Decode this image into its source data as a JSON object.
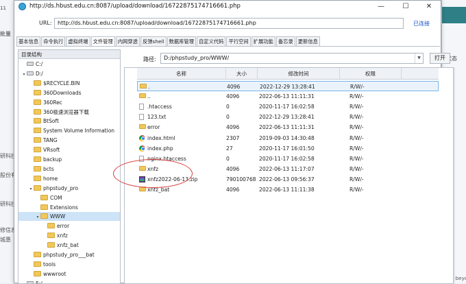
{
  "background": {
    "left_time": "11",
    "left_fragment": "批量",
    "left_side_labels": [
      "研科技",
      "股份有",
      "研科技",
      "修信息",
      "城惠"
    ],
    "status_column": "状态",
    "corner_text": "by rebeyon"
  },
  "window": {
    "title": "http://ds.hbust.edu.cn:8087/upload/download/16722875174716661.php",
    "minimize": "—",
    "maximize": "☐",
    "close": "✕"
  },
  "url_bar": {
    "label": "URL:",
    "value": "http://ds.hbust.edu.cn:8087/upload/download/16722875174716661.php",
    "status": "已连接"
  },
  "tabs": [
    "基本信息",
    "命令执行",
    "虚拟终端",
    "文件管理",
    "内网穿透",
    "反弹shell",
    "数据库管理",
    "自定义代码",
    "平行空间",
    "扩展功能",
    "备忘录",
    "更新信息"
  ],
  "active_tab": "文件管理",
  "tree": {
    "header": "目录结构",
    "nodes": [
      {
        "label": "C:/",
        "type": "drive",
        "depth": 1,
        "expander": ""
      },
      {
        "label": "D:/",
        "type": "drive",
        "depth": 1,
        "expander": "▾"
      },
      {
        "label": "$RECYCLE.BIN",
        "type": "folder",
        "depth": 2,
        "expander": ""
      },
      {
        "label": "360Downloads",
        "type": "folder",
        "depth": 2,
        "expander": ""
      },
      {
        "label": "360Rec",
        "type": "folder",
        "depth": 2,
        "expander": ""
      },
      {
        "label": "360极速浏览器下载",
        "type": "folder",
        "depth": 2,
        "expander": ""
      },
      {
        "label": "BtSoft",
        "type": "folder",
        "depth": 2,
        "expander": ""
      },
      {
        "label": "System Volume Information",
        "type": "folder",
        "depth": 2,
        "expander": ""
      },
      {
        "label": "TANG",
        "type": "folder",
        "depth": 2,
        "expander": ""
      },
      {
        "label": "VRsoft",
        "type": "folder",
        "depth": 2,
        "expander": ""
      },
      {
        "label": "backup",
        "type": "folder",
        "depth": 2,
        "expander": ""
      },
      {
        "label": "bcts",
        "type": "folder",
        "depth": 2,
        "expander": ""
      },
      {
        "label": "home",
        "type": "folder",
        "depth": 2,
        "expander": ""
      },
      {
        "label": "phpstudy_pro",
        "type": "folder",
        "depth": 2,
        "expander": "▾"
      },
      {
        "label": "COM",
        "type": "folder",
        "depth": 3,
        "expander": ""
      },
      {
        "label": "Extensions",
        "type": "folder",
        "depth": 3,
        "expander": ""
      },
      {
        "label": "WWW",
        "type": "folder",
        "depth": 3,
        "expander": "▾",
        "selected": true
      },
      {
        "label": "error",
        "type": "folder",
        "depth": 4,
        "expander": ""
      },
      {
        "label": "xnfz",
        "type": "folder",
        "depth": 4,
        "expander": ""
      },
      {
        "label": "xnfz_bat",
        "type": "folder",
        "depth": 4,
        "expander": ""
      },
      {
        "label": "phpstudy_pro___bat",
        "type": "folder",
        "depth": 2,
        "expander": ""
      },
      {
        "label": "tools",
        "type": "folder",
        "depth": 2,
        "expander": ""
      },
      {
        "label": "wwwroot",
        "type": "folder",
        "depth": 2,
        "expander": ""
      },
      {
        "label": "E:/",
        "type": "drive",
        "depth": 1,
        "expander": ""
      }
    ]
  },
  "path_bar": {
    "label": "路径:",
    "value": "D:/phpstudy_pro/WWW/",
    "open_button": "打开"
  },
  "file_list": {
    "columns": [
      "名称",
      "大小",
      "修改时间",
      "权限"
    ],
    "rows": [
      {
        "name": ".",
        "size": "4096",
        "mtime": "2022-12-29 13:28:41",
        "perm": "R/W/-",
        "icon": "folder-icon",
        "selected": true
      },
      {
        "name": "..",
        "size": "4096",
        "mtime": "2022-06-13 11:11:31",
        "perm": "R/W/-",
        "icon": "folder-icon"
      },
      {
        "name": ".htaccess",
        "size": "0",
        "mtime": "2020-11-17 16:02:58",
        "perm": "R/W/-",
        "icon": "file-icon"
      },
      {
        "name": "123.txt",
        "size": "0",
        "mtime": "2022-12-29 13:28:41",
        "perm": "R/W/-",
        "icon": "file-icon"
      },
      {
        "name": "error",
        "size": "4096",
        "mtime": "2022-06-13 11:11:31",
        "perm": "R/W/-",
        "icon": "folder-icon"
      },
      {
        "name": "index.html",
        "size": "2307",
        "mtime": "2019-09-03 14:30:48",
        "perm": "R/W/-",
        "icon": "chrome-icon"
      },
      {
        "name": "index.php",
        "size": "27",
        "mtime": "2020-11-17 16:01:50",
        "perm": "R/W/-",
        "icon": "chrome-icon"
      },
      {
        "name": "nginx.htaccess",
        "size": "0",
        "mtime": "2020-11-17 16:02:58",
        "perm": "R/W/-",
        "icon": "file-icon"
      },
      {
        "name": "xnfz",
        "size": "4096",
        "mtime": "2022-06-13 11:17:07",
        "perm": "R/W/-",
        "icon": "folder-icon"
      },
      {
        "name": "xnfz2022-06-13.zip",
        "size": "790100768",
        "mtime": "2022-06-13 09:56:37",
        "perm": "R/W/-",
        "icon": "zip-icon"
      },
      {
        "name": "xnfz_bat",
        "size": "4096",
        "mtime": "2022-06-13 11:11:38",
        "perm": "R/W/-",
        "icon": "folder-icon"
      }
    ]
  },
  "colors": {
    "annotation": "#d83a3a",
    "selection": "#cde3f7",
    "link": "#1a56c8"
  }
}
